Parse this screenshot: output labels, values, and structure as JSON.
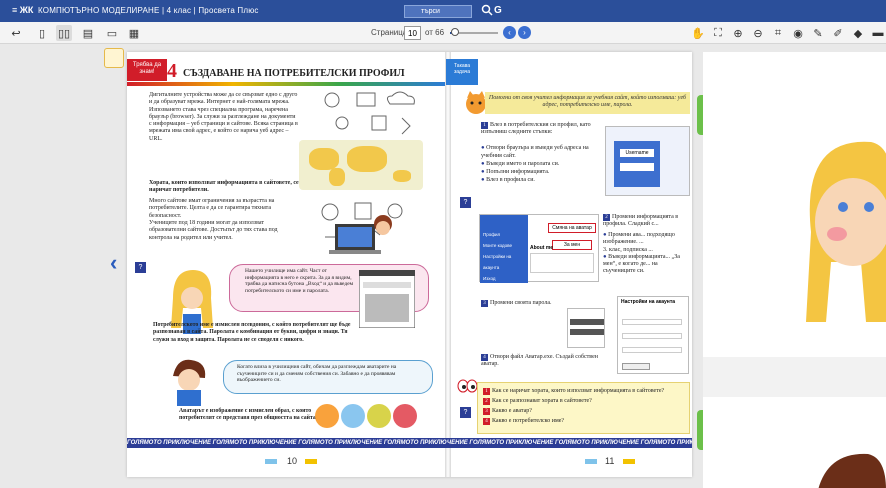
{
  "titlebar": {
    "logo": "≡ ЖК",
    "app_title": "КОМПЮТЪРНО МОДЕЛИРАНЕ | 4 клас | Просвета Плюс",
    "search_value": "търси"
  },
  "toolbar": {
    "page_label": "Страница",
    "page_value": "10",
    "page_total": "от 66",
    "zoom_fraction": 0.1
  },
  "book": {
    "left": {
      "tag": "Трябва да знам!",
      "lesson_number": "4",
      "lesson_title": "СЪЗДАВАНЕ НА ПОТРЕБИТЕЛСКИ ПРОФИЛ",
      "intro": "Дигиталните устройства може да се свързват едно с друго и да образуват мрежа. Интернет е най-голямата мрежа. Изпозването става чрез специална програма, наречена браузър (browser). За служи за разглеждане на документи с информация – уеб страници и сайтове. Всяка страница в мрежата има свой адрес, е който се нарича уеб адрес – URL.",
      "people": "Хората, които използват информацията в сайтовете, се наричат потребители.",
      "para2": "Много сайтове имат ограничения за възрастта на потребителите. Целта е да се гарантира тяхната безопасност.",
      "para3": "Учениците под 18 години могат да използват образователни сайтове. Достъпът до тях става под контрола на родител или учител.",
      "bubble1": "Нашето училище има сайт. Част от информацията в него е скрита. За да я видим, трябва да натисна бутона „Вход“ и да въведем потребителското си име и паролата.",
      "username_def": "Потребителското име е измислен псевдоним, с който потребителят ще бъде разпознаван в сайта. Паролата е комбинация от букви, цифри и знаци. Тя служи за вход и защита. Паролата не се споделя с никого.",
      "bubble2": "Когато влиза в училищния сайт, обичам да разглеждам аватарите на съучениците си и да сменям собствения си. Забавно е да проявявам въображението си.",
      "avatar_def": "Аватарът е изображение с измислен образ, с които потребителят се представя през общността на сайта.",
      "page_number": "10"
    },
    "right": {
      "tag": "Такава задача",
      "banner": "Помогни от своя учител информация за учебния сайт, който използваш: уеб адрес, потребителско име, парола.",
      "step1": "Влез в потребителския си профил, като изпълниш следните стъпки:",
      "step1_items": [
        "Отвори браузъра и въведи уеб адреса на учебния сайт.",
        "Въведи името и паролата си.",
        "Попълни информацията.",
        "Влез в профила си."
      ],
      "login_user": "Username",
      "step2": "Промени информацията в профила. Сладкий с...",
      "step2_items": [
        "Промени ава... подходящо изображение. ...",
        "Въведи информацията... „За мен“, е когато де... на съучениците си."
      ],
      "class_note": "3. клас, подписка ...",
      "menu_items": [
        "Профил",
        "Моите кодове",
        "Настройки на акаунта",
        "Изход"
      ],
      "callout1": "Смяна на аватар",
      "callout2": "За мен",
      "about_me": "About me",
      "step3": "Промени своята парола.",
      "settings_title": "Настройки на акаунта",
      "step4": "Отвори файл Аватар.exe. Създай собствен аватар.",
      "quiz": [
        "Как се наричат хората, които използват информацията в сайтовете?",
        "Как се разпознават хората в сайтовете?",
        "Какво е аватар?",
        "Какво е потребителско име?"
      ],
      "page_number": "11"
    },
    "footer_banner": "ГОЛЯМОТО ПРИКЛЮЧЕНИЕ   ГОЛЯМОТО ПРИКЛЮЧЕНИЕ   ГОЛЯМОТО ПРИКЛЮЧЕНИЕ   ГОЛЯМОТО ПРИКЛЮЧЕНИЕ   ГОЛЯМОТО ПРИКЛЮЧЕНИЕ   ГОЛЯМОТО ПРИКЛЮЧЕНИЕ   ГОЛЯМОТО ПРИКЛЮЧЕНИЕ"
  },
  "colors": {
    "titlebar": "#2b4f9a",
    "accent_red": "#d11d29",
    "accent_blue": "#2b3e96",
    "banner_yellow": "#f5ea9a",
    "tab_green": "#6cc04a"
  }
}
